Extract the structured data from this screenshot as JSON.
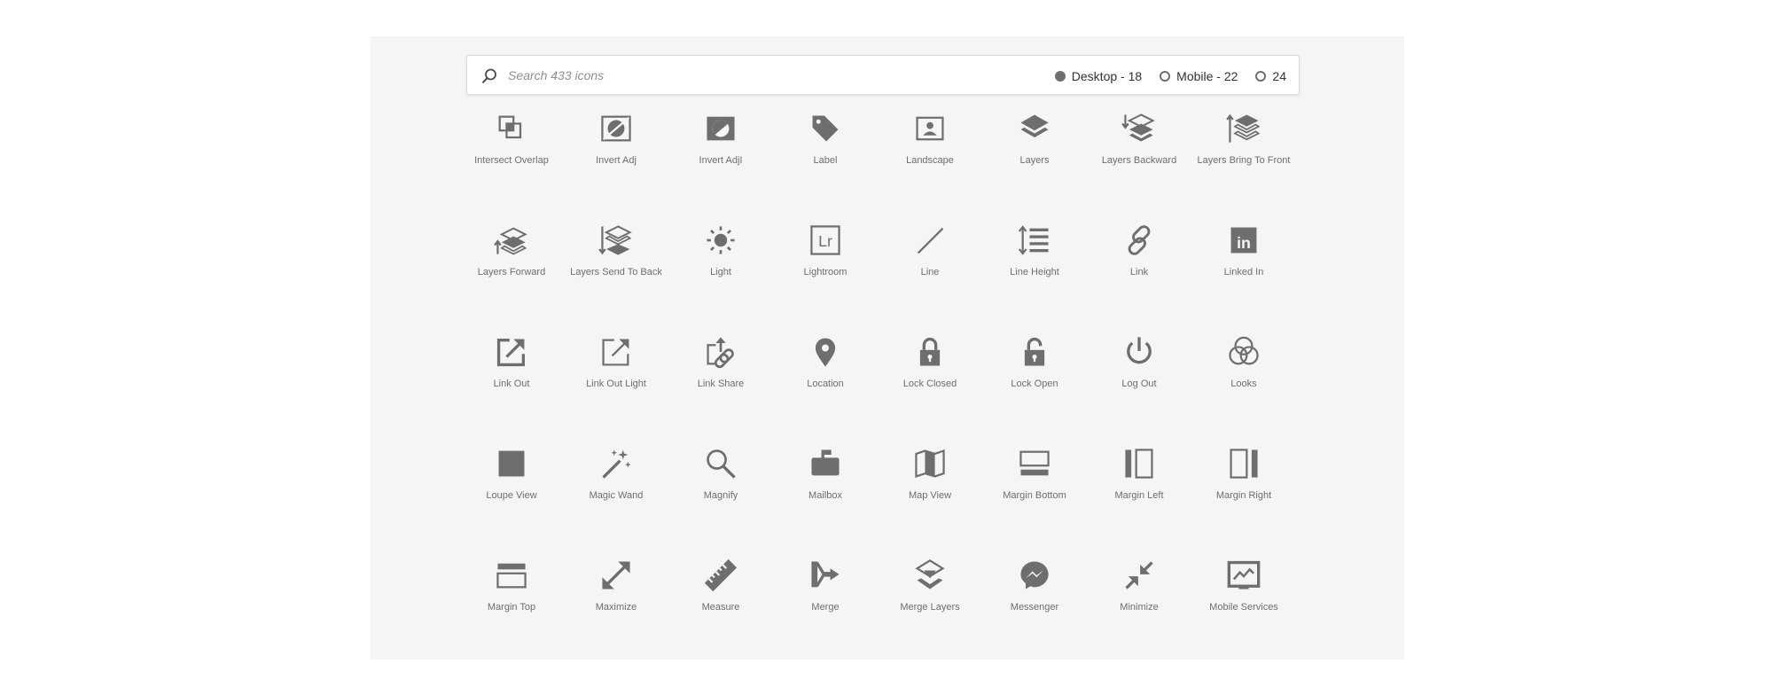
{
  "search": {
    "placeholder": "Search 433 icons",
    "value": ""
  },
  "size_options": [
    {
      "label": "Desktop - 18",
      "selected": true
    },
    {
      "label": "Mobile - 22",
      "selected": false
    },
    {
      "label": "24",
      "selected": false
    }
  ],
  "colors": {
    "icon": "#6e6e6e",
    "panel": "#f5f5f5",
    "label": "#6e6e6e"
  },
  "icons": [
    {
      "label": "Intersect Overlap",
      "icon": "intersect-overlap"
    },
    {
      "label": "Invert Adj",
      "icon": "invert-adj"
    },
    {
      "label": "Invert AdjI",
      "icon": "invert-adj-i"
    },
    {
      "label": "Label",
      "icon": "label"
    },
    {
      "label": "Landscape",
      "icon": "landscape"
    },
    {
      "label": "Layers",
      "icon": "layers"
    },
    {
      "label": "Layers Backward",
      "icon": "layers-backward"
    },
    {
      "label": "Layers Bring To Front",
      "icon": "layers-bring-to-front"
    },
    {
      "label": "Layers Forward",
      "icon": "layers-forward"
    },
    {
      "label": "Layers Send To Back",
      "icon": "layers-send-to-back"
    },
    {
      "label": "Light",
      "icon": "light"
    },
    {
      "label": "Lightroom",
      "icon": "lightroom",
      "glyph_text": "Lr"
    },
    {
      "label": "Line",
      "icon": "line"
    },
    {
      "label": "Line Height",
      "icon": "line-height"
    },
    {
      "label": "Link",
      "icon": "link"
    },
    {
      "label": "Linked In",
      "icon": "linked-in",
      "glyph_text": "in"
    },
    {
      "label": "Link Out",
      "icon": "link-out"
    },
    {
      "label": "Link Out Light",
      "icon": "link-out-light"
    },
    {
      "label": "Link Share",
      "icon": "link-share"
    },
    {
      "label": "Location",
      "icon": "location"
    },
    {
      "label": "Lock Closed",
      "icon": "lock-closed"
    },
    {
      "label": "Lock Open",
      "icon": "lock-open"
    },
    {
      "label": "Log Out",
      "icon": "log-out"
    },
    {
      "label": "Looks",
      "icon": "looks"
    },
    {
      "label": "Loupe View",
      "icon": "loupe-view"
    },
    {
      "label": "Magic Wand",
      "icon": "magic-wand"
    },
    {
      "label": "Magnify",
      "icon": "magnify"
    },
    {
      "label": "Mailbox",
      "icon": "mailbox"
    },
    {
      "label": "Map View",
      "icon": "map-view"
    },
    {
      "label": "Margin Bottom",
      "icon": "margin-bottom"
    },
    {
      "label": "Margin Left",
      "icon": "margin-left"
    },
    {
      "label": "Margin Right",
      "icon": "margin-right"
    },
    {
      "label": "Margin Top",
      "icon": "margin-top"
    },
    {
      "label": "Maximize",
      "icon": "maximize"
    },
    {
      "label": "Measure",
      "icon": "measure"
    },
    {
      "label": "Merge",
      "icon": "merge"
    },
    {
      "label": "Merge Layers",
      "icon": "merge-layers"
    },
    {
      "label": "Messenger",
      "icon": "messenger"
    },
    {
      "label": "Minimize",
      "icon": "minimize"
    },
    {
      "label": "Mobile Services",
      "icon": "mobile-services"
    }
  ]
}
